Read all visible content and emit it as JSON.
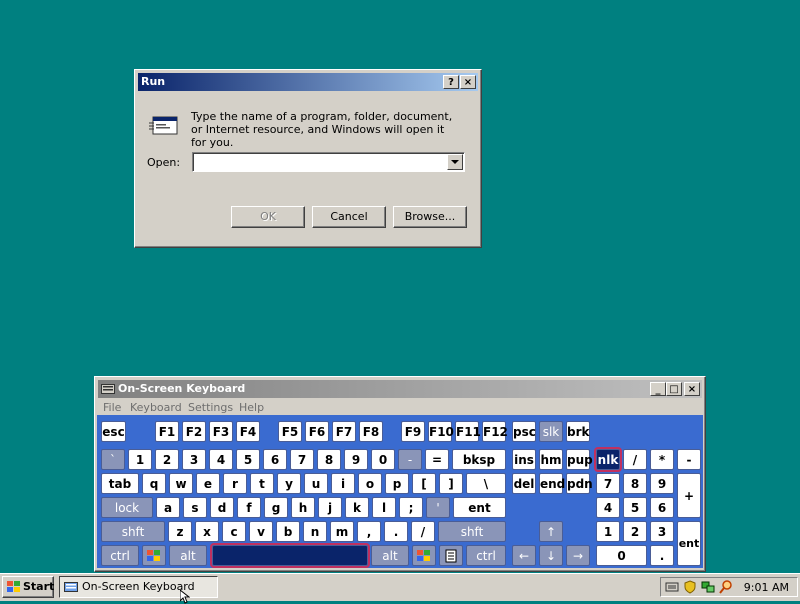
{
  "run": {
    "title": "Run",
    "help_btn": "?",
    "close_btn": "×",
    "description": "Type the name of a program, folder, document, or Internet resource, and Windows will open it for you.",
    "open_label": "Open:",
    "open_value": "",
    "ok": "OK",
    "cancel": "Cancel",
    "browse": "Browse..."
  },
  "osk": {
    "title": "On-Screen Keyboard",
    "menu": [
      "File",
      "Keyboard",
      "Settings",
      "Help"
    ],
    "min_btn": "_",
    "max_btn": "□",
    "close_btn": "×",
    "keys": [
      "esc",
      "F1",
      "F2",
      "F3",
      "F4",
      "F5",
      "F6",
      "F7",
      "F8",
      "F9",
      "F10",
      "F11",
      "F12",
      "psc",
      "slk",
      "brk",
      "`",
      "1",
      "2",
      "3",
      "4",
      "5",
      "6",
      "7",
      "8",
      "9",
      "0",
      "-",
      "=",
      "bksp",
      "ins",
      "hm",
      "pup",
      "nlk",
      "/",
      "*",
      "-",
      "tab",
      "q",
      "w",
      "e",
      "r",
      "t",
      "y",
      "u",
      "i",
      "o",
      "p",
      "[",
      "]",
      "\\",
      "del",
      "end",
      "pdn",
      "7",
      "8",
      "9",
      "+",
      "lock",
      "a",
      "s",
      "d",
      "f",
      "g",
      "h",
      "j",
      "k",
      "l",
      ";",
      "'",
      "ent",
      "4",
      "5",
      "6",
      "shft",
      "z",
      "x",
      "c",
      "v",
      "b",
      "n",
      "m",
      ",",
      ".",
      "/",
      "shft",
      "↑",
      "1",
      "2",
      "3",
      "ent",
      "ctrl",
      "",
      "alt",
      "",
      "alt",
      "",
      "",
      "ctrl",
      "←",
      "↓",
      "→",
      "0",
      "."
    ]
  },
  "taskbar": {
    "start": "Start",
    "task": "On-Screen Keyboard",
    "clock": "9:01 AM"
  }
}
